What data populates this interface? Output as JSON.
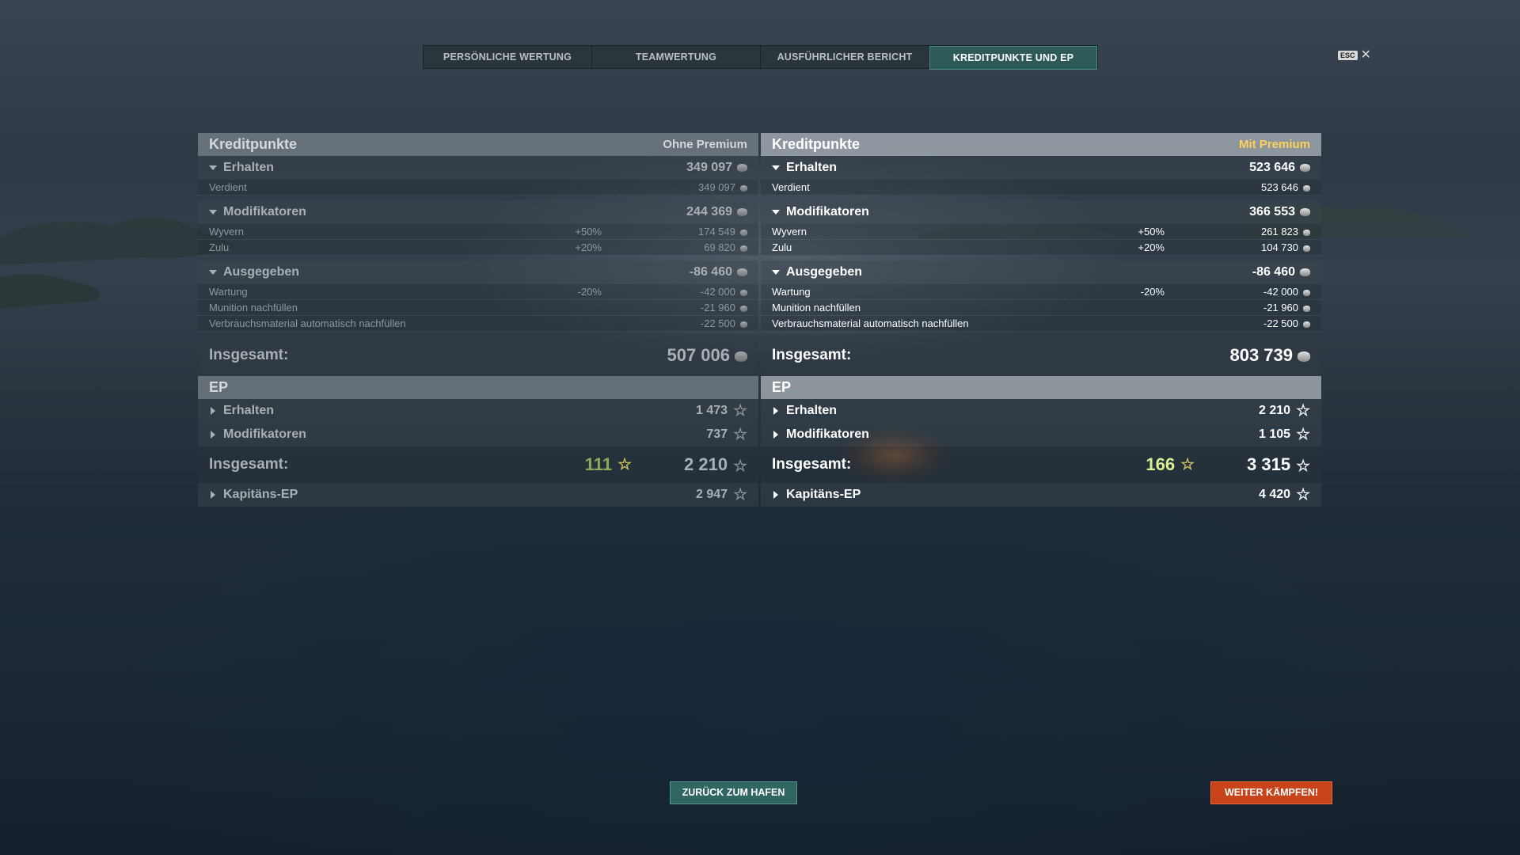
{
  "tabs": [
    {
      "label": "PERSÖNLICHE WERTUNG"
    },
    {
      "label": "TEAMWERTUNG"
    },
    {
      "label": "AUSFÜHRLICHER BERICHT"
    },
    {
      "label": "KREDITPUNKTE UND EP",
      "active": true
    }
  ],
  "esc": {
    "key": "ESC"
  },
  "left": {
    "credits_title": "Kreditpunkte",
    "tag": "Ohne Premium",
    "erhalten": {
      "label": "Erhalten",
      "value": "349 097"
    },
    "verdient": {
      "label": "Verdient",
      "value": "349 097"
    },
    "modifikatoren": {
      "label": "Modifikatoren",
      "value": "244 369"
    },
    "wyvern": {
      "label": "Wyvern",
      "pct": "+50%",
      "value": "174 549"
    },
    "zulu": {
      "label": "Zulu",
      "pct": "+20%",
      "value": "69 820"
    },
    "ausgegeben": {
      "label": "Ausgegeben",
      "value": "-86 460"
    },
    "wartung": {
      "label": "Wartung",
      "pct": "-20%",
      "value": "-42 000"
    },
    "munition": {
      "label": "Munition nachfüllen",
      "value": "-21 960"
    },
    "verbrauch": {
      "label": "Verbrauchsmaterial automatisch nachfüllen",
      "value": "-22 500"
    },
    "total": {
      "label": "Insgesamt:",
      "value": "507 006"
    },
    "ep_title": "EP",
    "ep_erhalten": {
      "label": "Erhalten",
      "value": "1 473"
    },
    "ep_mod": {
      "label": "Modifikatoren",
      "value": "737"
    },
    "ep_total": {
      "label": "Insgesamt:",
      "bonus": "111",
      "value": "2 210"
    },
    "captain": {
      "label": "Kapitäns-EP",
      "value": "2 947"
    }
  },
  "right": {
    "credits_title": "Kreditpunkte",
    "tag": "Mit Premium",
    "erhalten": {
      "label": "Erhalten",
      "value": "523 646"
    },
    "verdient": {
      "label": "Verdient",
      "value": "523 646"
    },
    "modifikatoren": {
      "label": "Modifikatoren",
      "value": "366 553"
    },
    "wyvern": {
      "label": "Wyvern",
      "pct": "+50%",
      "value": "261 823"
    },
    "zulu": {
      "label": "Zulu",
      "pct": "+20%",
      "value": "104 730"
    },
    "ausgegeben": {
      "label": "Ausgegeben",
      "value": "-86 460"
    },
    "wartung": {
      "label": "Wartung",
      "pct": "-20%",
      "value": "-42 000"
    },
    "munition": {
      "label": "Munition nachfüllen",
      "value": "-21 960"
    },
    "verbrauch": {
      "label": "Verbrauchsmaterial automatisch nachfüllen",
      "value": "-22 500"
    },
    "total": {
      "label": "Insgesamt:",
      "value": "803 739"
    },
    "ep_title": "EP",
    "ep_erhalten": {
      "label": "Erhalten",
      "value": "2 210"
    },
    "ep_mod": {
      "label": "Modifikatoren",
      "value": "1 105"
    },
    "ep_total": {
      "label": "Insgesamt:",
      "bonus": "166",
      "value": "3 315"
    },
    "captain": {
      "label": "Kapitäns-EP",
      "value": "4 420"
    }
  },
  "footer": {
    "harbor_label": "ZURÜCK ZUM HAFEN",
    "fight_label": "WEITER KÄMPFEN!"
  },
  "colors": {
    "premium": "#ffd257",
    "active_tab": "#2d5a57",
    "fight_button": "#c8421a",
    "harbor_button": "#2f6662"
  }
}
